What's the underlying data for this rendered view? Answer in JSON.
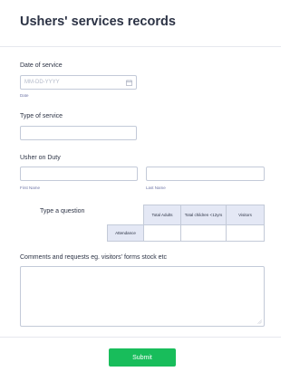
{
  "form": {
    "title": "Ushers' services records"
  },
  "date_of_service": {
    "label": "Date of service",
    "placeholder": "MM-DD-YYYY",
    "sublabel": "Date",
    "icon": "calendar-icon"
  },
  "type_of_service": {
    "label": "Type of service",
    "value": ""
  },
  "usher_on_duty": {
    "label": "Usher on Duty",
    "first_sublabel": "First Name",
    "last_sublabel": "Last Name"
  },
  "matrix": {
    "question_label": "Type a question",
    "columns": [
      "Total Adults",
      "Total children <12yrs",
      "Visitors"
    ],
    "rows": [
      "Attendance"
    ]
  },
  "comments": {
    "label": "Comments and requests eg. visitors' forms stock etc",
    "value": ""
  },
  "submit": {
    "label": "Submit",
    "color": "#18bd5b"
  }
}
